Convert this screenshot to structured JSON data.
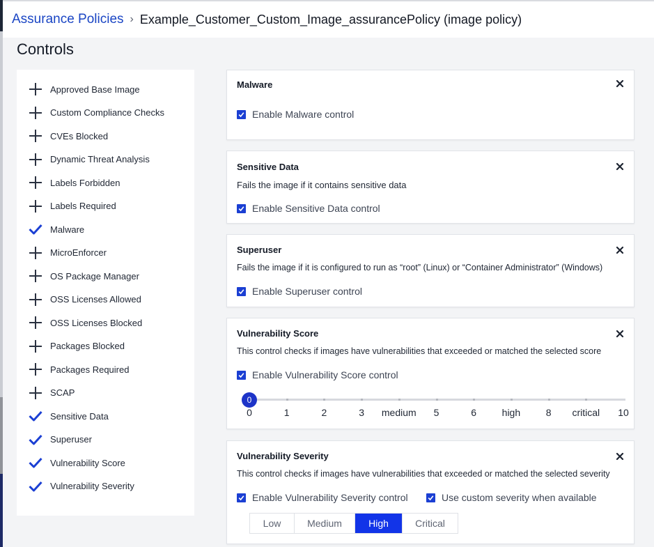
{
  "breadcrumb": {
    "parent": "Assurance Policies",
    "separator": "›",
    "current": "Example_Customer_Custom_Image_assurancePolicy (image policy)"
  },
  "page_title": "Controls",
  "sidebar": {
    "items": [
      {
        "label": "Approved Base Image",
        "state": "add"
      },
      {
        "label": "Custom Compliance Checks",
        "state": "add"
      },
      {
        "label": "CVEs Blocked",
        "state": "add"
      },
      {
        "label": "Dynamic Threat Analysis",
        "state": "add"
      },
      {
        "label": "Labels Forbidden",
        "state": "add"
      },
      {
        "label": "Labels Required",
        "state": "add"
      },
      {
        "label": "Malware",
        "state": "added"
      },
      {
        "label": "MicroEnforcer",
        "state": "add"
      },
      {
        "label": "OS Package Manager",
        "state": "add"
      },
      {
        "label": "OSS Licenses Allowed",
        "state": "add"
      },
      {
        "label": "OSS Licenses Blocked",
        "state": "add"
      },
      {
        "label": "Packages Blocked",
        "state": "add"
      },
      {
        "label": "Packages Required",
        "state": "add"
      },
      {
        "label": "SCAP",
        "state": "add"
      },
      {
        "label": "Sensitive Data",
        "state": "added"
      },
      {
        "label": "Superuser",
        "state": "added"
      },
      {
        "label": "Vulnerability Score",
        "state": "added"
      },
      {
        "label": "Vulnerability Severity",
        "state": "added"
      }
    ]
  },
  "cards": {
    "malware": {
      "title": "Malware",
      "checkbox": "Enable Malware control",
      "checked": true
    },
    "sensitive": {
      "title": "Sensitive Data",
      "description": "Fails the image if it contains sensitive data",
      "checkbox": "Enable Sensitive Data control",
      "checked": true
    },
    "superuser": {
      "title": "Superuser",
      "description": "Fails the image if it is configured to run as “root” (Linux) or “Container Administrator” (Windows)",
      "checkbox": "Enable Superuser control",
      "checked": true
    },
    "vuln_score": {
      "title": "Vulnerability Score",
      "description": "This control checks if images have vulnerabilities that exceeded or matched the selected score",
      "checkbox": "Enable Vulnerability Score control",
      "checked": true,
      "slider_value": "0",
      "slider_labels": [
        "0",
        "1",
        "2",
        "3",
        "medium",
        "5",
        "6",
        "high",
        "8",
        "critical",
        "10"
      ]
    },
    "vuln_severity": {
      "title": "Vulnerability Severity",
      "description": "This control checks if images have vulnerabilities that exceeded or matched the selected severity",
      "checkbox": "Enable Vulnerability Severity control",
      "checkbox2": "Use custom severity when available",
      "checked": true,
      "checked2": true,
      "options": [
        "Low",
        "Medium",
        "High",
        "Critical"
      ],
      "selected": "High"
    }
  },
  "icons": {
    "add": "plus-icon",
    "added": "check-icon",
    "close": "close-icon",
    "checkbox": "checkmark-icon"
  },
  "colors": {
    "accent": "#1234e8",
    "link": "#1a45c4",
    "check": "#1b3fd3"
  }
}
